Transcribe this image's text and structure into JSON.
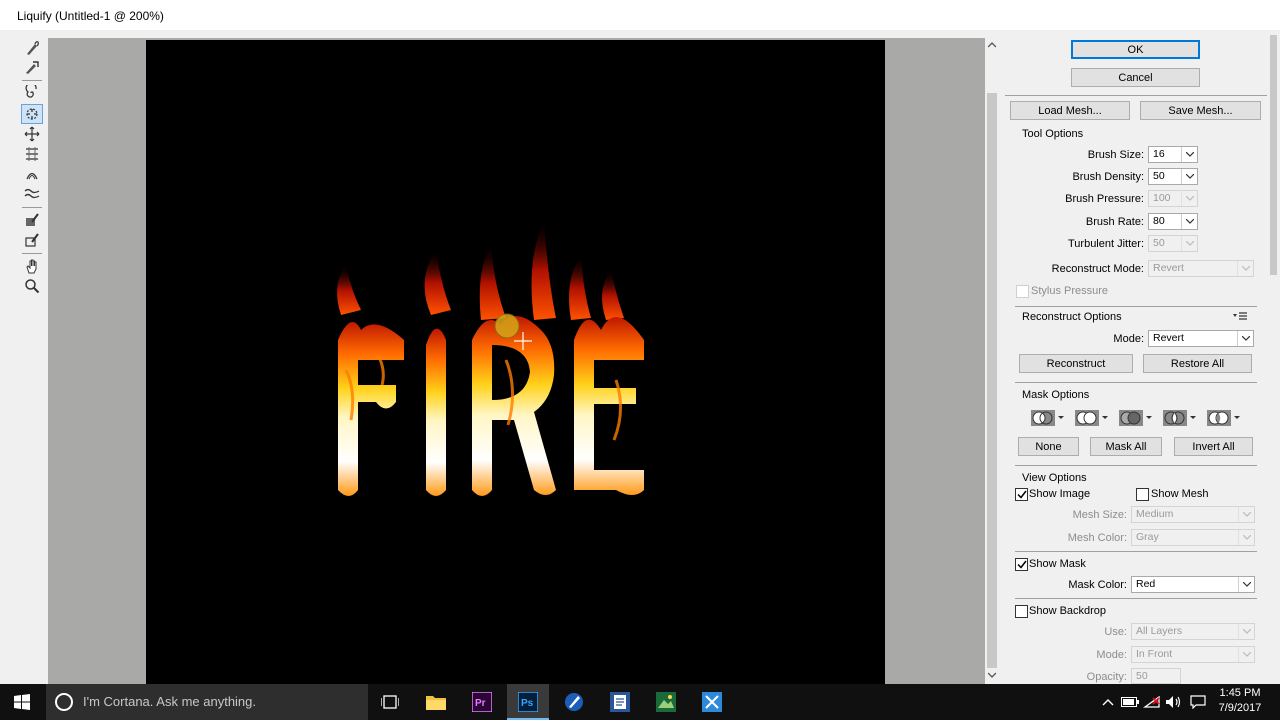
{
  "window": {
    "title": "Liquify (Untitled-1 @ 200%)"
  },
  "canvas": {
    "text": "FIRE"
  },
  "buttons": {
    "ok": "OK",
    "cancel": "Cancel",
    "load_mesh": "Load Mesh...",
    "save_mesh": "Save Mesh..."
  },
  "tool_options": {
    "heading": "Tool Options",
    "brush_size_label": "Brush Size:",
    "brush_size": "16",
    "brush_density_label": "Brush Density:",
    "brush_density": "50",
    "brush_pressure_label": "Brush Pressure:",
    "brush_pressure": "100",
    "brush_rate_label": "Brush Rate:",
    "brush_rate": "80",
    "turbulent_jitter_label": "Turbulent Jitter:",
    "turbulent_jitter": "50",
    "reconstruct_mode_label": "Reconstruct Mode:",
    "reconstruct_mode": "Revert",
    "stylus_pressure": "Stylus Pressure"
  },
  "reconstruct_options": {
    "heading": "Reconstruct Options",
    "mode_label": "Mode:",
    "mode": "Revert",
    "reconstruct": "Reconstruct",
    "restore_all": "Restore All"
  },
  "mask_options": {
    "heading": "Mask Options",
    "none": "None",
    "mask_all": "Mask All",
    "invert_all": "Invert All"
  },
  "view_options": {
    "heading": "View Options",
    "show_image": "Show Image",
    "show_mesh": "Show Mesh",
    "mesh_size_label": "Mesh Size:",
    "mesh_size": "Medium",
    "mesh_color_label": "Mesh Color:",
    "mesh_color": "Gray",
    "show_mask": "Show Mask",
    "mask_color_label": "Mask Color:",
    "mask_color": "Red",
    "show_backdrop": "Show Backdrop",
    "use_label": "Use:",
    "use": "All Layers",
    "mode_label": "Mode:",
    "mode": "In Front",
    "opacity_label": "Opacity:",
    "opacity": "50"
  },
  "taskbar": {
    "search_placeholder": "I'm Cortana. Ask me anything.",
    "time": "1:45 PM",
    "date": "7/9/2017"
  },
  "colors": {
    "accent": "#0078d7",
    "fire_yellow": "#ffd21a",
    "fire_orange": "#ff6a00",
    "fire_red": "#c01800"
  }
}
